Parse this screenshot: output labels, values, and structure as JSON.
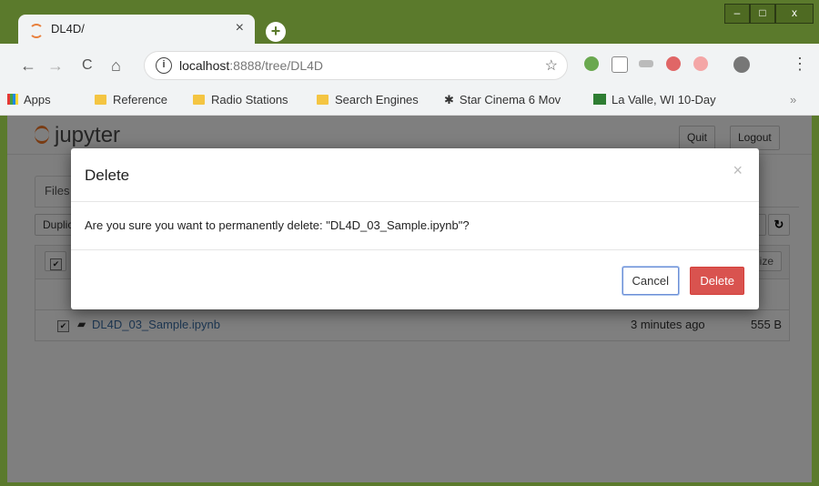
{
  "tab": {
    "title": "DL4D/",
    "close": "×",
    "new_tab": "+"
  },
  "window_controls": {
    "minimize": "–",
    "maximize": "□",
    "close": "x"
  },
  "toolbar": {
    "back": "←",
    "forward": "→",
    "reload": "C",
    "home": "⌂",
    "url_host": "localhost",
    "url_rest": ":8888/tree/DL4D",
    "info": "i",
    "star": "☆",
    "menu": "⋮"
  },
  "bookmarks": {
    "apps": "Apps",
    "items": [
      "Reference",
      "Radio Stations",
      "Search Engines",
      "Star Cinema 6 Mov",
      "La Valle, WI 10-Day"
    ],
    "overflow": "»"
  },
  "jupyter": {
    "logo": "jupyter",
    "quit": "Quit",
    "logout": "Logout",
    "files_tab": "Files",
    "duplicate": "Duplicate",
    "size_header": "Size",
    "refresh": "↻",
    "file": {
      "name": "DL4D_03_Sample.ipynb",
      "modified": "3 minutes ago",
      "size": "555 B",
      "checked": "✔"
    }
  },
  "modal": {
    "title": "Delete",
    "close": "×",
    "message": "Are you sure you want to permanently delete: \"DL4D_03_Sample.ipynb\"?",
    "cancel": "Cancel",
    "delete": "Delete"
  },
  "colors": {
    "frame": "#5b7a2c",
    "delete_button": "#d9534f",
    "link": "#3a6ea5",
    "jupyter_orange": "#f37626"
  }
}
